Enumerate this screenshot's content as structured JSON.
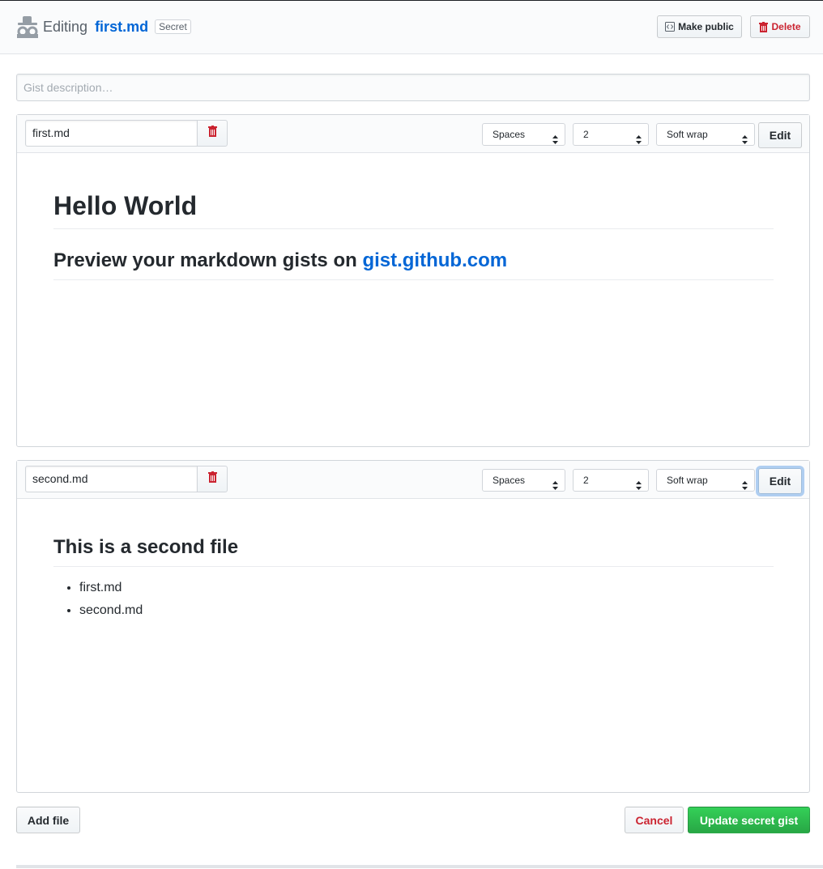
{
  "header": {
    "editing_word": "Editing",
    "file_name": "first.md",
    "visibility_badge": "Secret",
    "make_public_label": "Make public",
    "delete_label": "Delete"
  },
  "description": {
    "placeholder": "Gist description…",
    "value": ""
  },
  "files": [
    {
      "filename": "first.md",
      "indent_mode": "Spaces",
      "indent_size": "2",
      "wrap_mode": "Soft wrap",
      "edit_label": "Edit",
      "preview": {
        "h1": "Hello World",
        "h2_text": "Preview your markdown gists on ",
        "h2_link": "gist.github.com"
      }
    },
    {
      "filename": "second.md",
      "indent_mode": "Spaces",
      "indent_size": "2",
      "wrap_mode": "Soft wrap",
      "edit_label": "Edit",
      "preview": {
        "h2": "This is a second file",
        "list": [
          "first.md",
          "second.md"
        ]
      }
    }
  ],
  "footer": {
    "add_file_label": "Add file",
    "cancel_label": "Cancel",
    "update_label": "Update secret gist"
  },
  "colors": {
    "link": "#0366d6",
    "danger": "#cb2431",
    "primary": "#28a745"
  },
  "icons": {
    "gist_secret": "incognito-icon",
    "make_public": "code-file-icon",
    "delete": "trash-icon"
  }
}
